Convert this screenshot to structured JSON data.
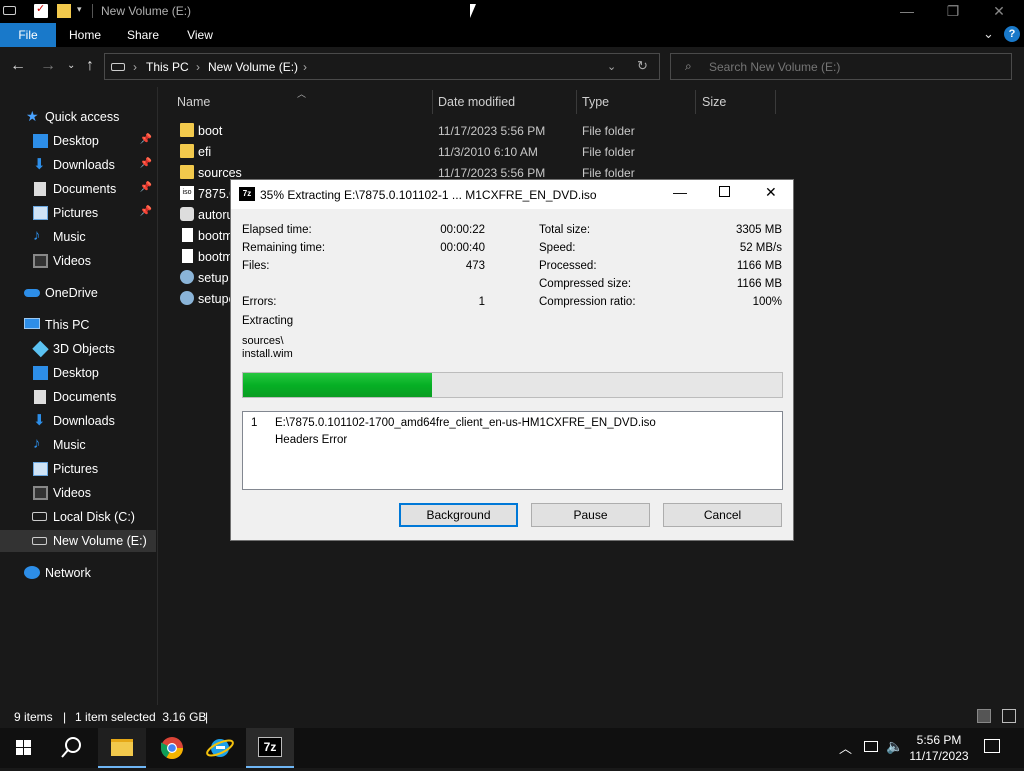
{
  "window": {
    "title": "New Volume (E:)"
  },
  "ribbon": {
    "tabs": [
      "File",
      "Home",
      "Share",
      "View"
    ]
  },
  "address": {
    "crumbs": [
      "This PC",
      "New Volume (E:)"
    ]
  },
  "search": {
    "placeholder": "Search New Volume (E:)"
  },
  "sidebar": {
    "quick_access": "Quick access",
    "quick_items": [
      "Desktop",
      "Downloads",
      "Documents",
      "Pictures",
      "Music",
      "Videos"
    ],
    "onedrive": "OneDrive",
    "this_pc": "This PC",
    "pc_items": [
      "3D Objects",
      "Desktop",
      "Documents",
      "Downloads",
      "Music",
      "Pictures",
      "Videos",
      "Local Disk (C:)",
      "New Volume (E:)"
    ],
    "network": "Network"
  },
  "columns": {
    "name": "Name",
    "date": "Date modified",
    "type": "Type",
    "size": "Size"
  },
  "files": [
    {
      "name": "boot",
      "date": "11/17/2023 5:56 PM",
      "type": "File folder"
    },
    {
      "name": "efi",
      "date": "11/3/2010 6:10 AM",
      "type": "File folder"
    },
    {
      "name": "sources",
      "date": "11/17/2023 5:56 PM",
      "type": "File folder"
    },
    {
      "name": "7875.0",
      "date": "",
      "type": ""
    },
    {
      "name": "autoru",
      "date": "",
      "type": ""
    },
    {
      "name": "bootm",
      "date": "",
      "type": ""
    },
    {
      "name": "bootm",
      "date": "",
      "type": ""
    },
    {
      "name": "setup",
      "date": "",
      "type": ""
    },
    {
      "name": "setupe",
      "date": "",
      "type": ""
    }
  ],
  "status": {
    "items": "9 items",
    "selected": "1 item selected  3.16 GB"
  },
  "dialog": {
    "title": "35% Extracting E:\\7875.0.101102-1 ... M1CXFRE_EN_DVD.iso",
    "elapsed_label": "Elapsed time:",
    "elapsed": "00:00:22",
    "remaining_label": "Remaining time:",
    "remaining": "00:00:40",
    "files_label": "Files:",
    "files": "473",
    "errors_label": "Errors:",
    "errors": "1",
    "total_label": "Total size:",
    "total": "3305 MB",
    "speed_label": "Speed:",
    "speed": "52 MB/s",
    "processed_label": "Processed:",
    "processed": "1166 MB",
    "compressed_label": "Compressed size:",
    "compressed": "1166 MB",
    "ratio_label": "Compression ratio:",
    "ratio": "100%",
    "extracting_label": "Extracting",
    "current_dir": "sources\\",
    "current_file": "install.wim",
    "progress": 0.35,
    "log_num": "1",
    "log_path": "E:\\7875.0.101102-1700_amd64fre_client_en-us-HM1CXFRE_EN_DVD.iso",
    "log_msg": "Headers Error",
    "btn_background": "Background",
    "btn_pause": "Pause",
    "btn_cancel": "Cancel"
  },
  "clock": {
    "time": "5:56 PM",
    "date": "11/17/2023"
  },
  "colors": {
    "accent": "#1979ca",
    "progress": "#06b025",
    "folder": "#f2c94c"
  }
}
